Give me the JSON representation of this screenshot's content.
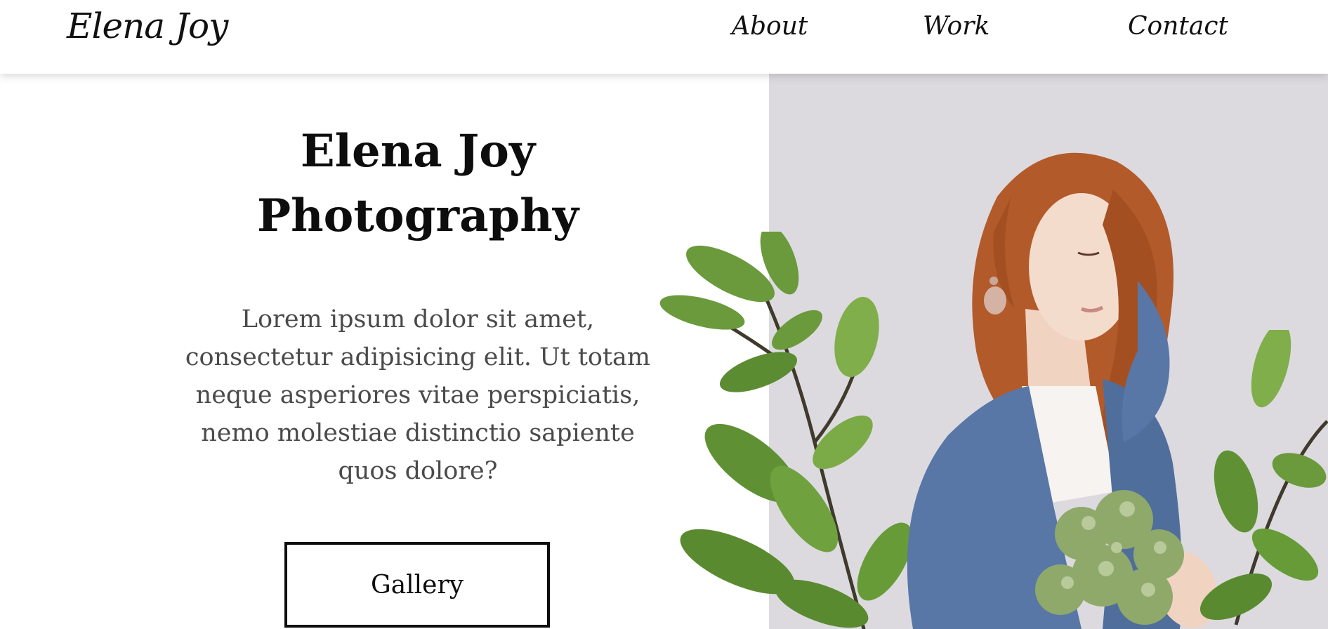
{
  "header": {
    "logo": "Elena Joy",
    "nav": {
      "about": "About",
      "work": "Work",
      "contact": "Contact"
    }
  },
  "hero": {
    "title_line1": "Elena Joy",
    "title_line2": "Photography",
    "body": "Lorem ipsum dolor sit amet, consectetur adipisicing elit. Ut totam neque asperiores vitae perspiciatis, nemo molestiae distinctio sapiente quos dolore?",
    "button_label": "Gallery"
  },
  "colors": {
    "text_primary": "#0d0d0d",
    "text_body": "#4a4a4a",
    "photo_background": "#dcdadf",
    "hair": "#b35a2a",
    "cardigan": "#5877a6",
    "leaf_green": "#6a9a3c"
  },
  "images": {
    "hero_photo": "portrait-woman-with-flowers",
    "decor": "green-leaves"
  }
}
